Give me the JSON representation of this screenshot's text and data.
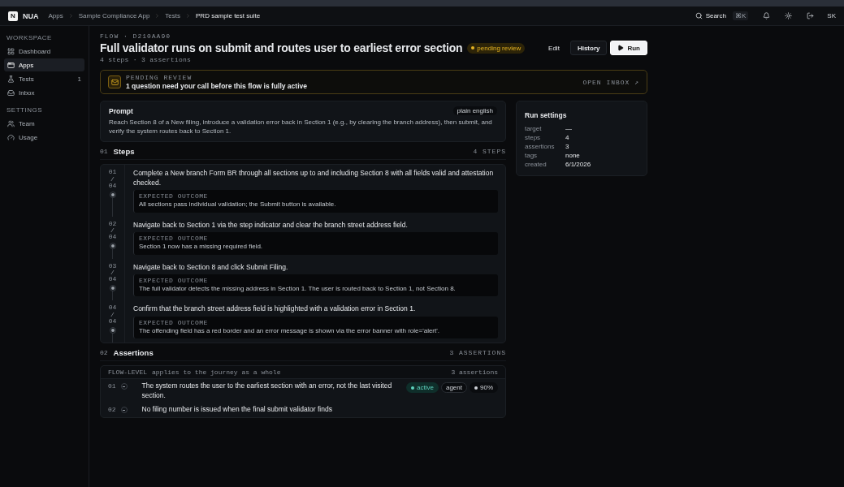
{
  "header": {
    "logo": "N",
    "brand": "NUA",
    "breadcrumbs": [
      "Apps",
      "Sample Compliance App",
      "Tests",
      "PRD sample test suite"
    ],
    "search": {
      "label": "Search",
      "shortcut": "⌘K"
    },
    "avatar": "SK"
  },
  "sidebar": {
    "sections": [
      {
        "title": "WORKSPACE",
        "items": [
          {
            "label": "Dashboard",
            "selected": false
          },
          {
            "label": "Apps",
            "selected": true
          },
          {
            "label": "Tests",
            "selected": false,
            "count": "1"
          },
          {
            "label": "Inbox",
            "selected": false
          }
        ]
      },
      {
        "title": "SETTINGS",
        "items": [
          {
            "label": "Team",
            "selected": false
          },
          {
            "label": "Usage",
            "selected": false
          }
        ]
      }
    ]
  },
  "flow": {
    "eyebrow": "FLOW · D210AA90",
    "title": "Full validator runs on submit and routes user to earliest error section",
    "status": "pending review",
    "meta": "4 steps · 3 assertions",
    "actions": [
      "Edit",
      "History",
      "Run"
    ]
  },
  "review_banner": {
    "label": "PENDING REVIEW",
    "message": "1 question need your call before this flow is fully active",
    "link": "OPEN INBOX ↗"
  },
  "prompt": {
    "title": "Prompt",
    "tag": "plain english",
    "text": "Reach Section 8 of a New filing, introduce a validation error back in Section 1 (e.g., by clearing the branch address), then submit, and verify the system routes back to Section 1."
  },
  "run_settings": {
    "title": "Run settings",
    "rows": [
      {
        "key": "target",
        "value": "—"
      },
      {
        "key": "steps",
        "value": "4"
      },
      {
        "key": "assertions",
        "value": "3"
      },
      {
        "key": "tags",
        "value": "none"
      },
      {
        "key": "created",
        "value": "6/1/2026"
      }
    ]
  },
  "steps": {
    "index": "01",
    "title": "Steps",
    "count": "4 STEPS",
    "items": [
      {
        "number": "01 / 04",
        "text": "Complete a New branch Form BR through all sections up to and including Section 8 with all fields valid and attestation checked.",
        "outcome_label": "EXPECTED OUTCOME",
        "outcome": "All sections pass individual validation; the Submit button is available."
      },
      {
        "number": "02 / 04",
        "text": "Navigate back to Section 1 via the step indicator and clear the branch street address field.",
        "outcome_label": "EXPECTED OUTCOME",
        "outcome": "Section 1 now has a missing required field."
      },
      {
        "number": "03 / 04",
        "text": "Navigate back to Section 8 and click Submit Filing.",
        "outcome_label": "EXPECTED OUTCOME",
        "outcome": "The full validator detects the missing address in Section 1. The user is routed back to Section 1, not Section 8."
      },
      {
        "number": "04 / 04",
        "text": "Confirm that the branch street address field is highlighted with a validation error in Section 1.",
        "outcome_label": "EXPECTED OUTCOME",
        "outcome": "The offending field has a red border and an error message is shown via the error banner with role='alert'."
      }
    ]
  },
  "assertions": {
    "index": "02",
    "title": "Assertions",
    "count": "3 ASSERTIONS",
    "group": {
      "label": "FLOW-LEVEL",
      "note": "applies to the journey as a whole",
      "count": "3 assertions"
    },
    "items": [
      {
        "number": "01",
        "text": "The system routes the user to the earliest section with an error, not the last visited section.",
        "badges": [
          {
            "kind": "status",
            "label": "active"
          },
          {
            "kind": "source",
            "label": "agent"
          },
          {
            "kind": "confidence",
            "label": "90%"
          }
        ]
      },
      {
        "number": "02",
        "text": "No filing number is issued when the final submit validator finds"
      }
    ]
  }
}
